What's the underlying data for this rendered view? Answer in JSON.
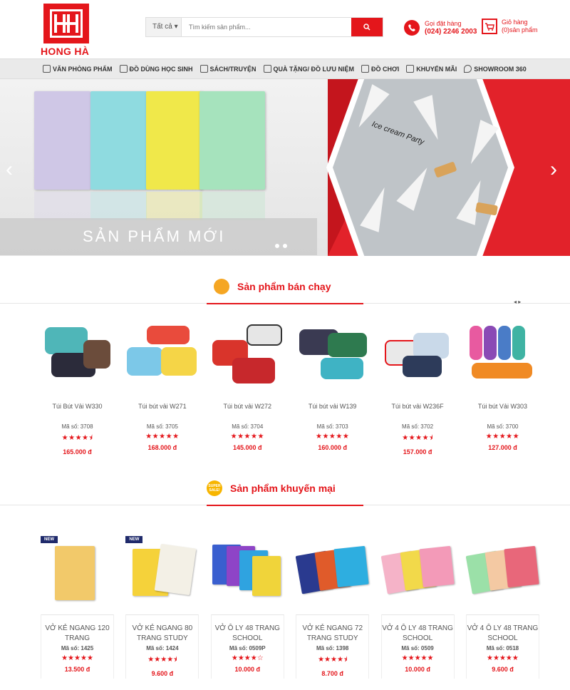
{
  "header": {
    "logo_text": "HONG HÀ",
    "search": {
      "category": "Tất cả",
      "placeholder": "Tìm kiếm sản phẩm..."
    },
    "hotline": {
      "label": "Gọi đặt hàng",
      "number": "(024) 2246 2003"
    },
    "cart": {
      "label": "Giỏ hàng",
      "count_text": "(0)sản phẩm"
    }
  },
  "nav": {
    "items": [
      {
        "label": "VĂN PHÒNG PHẨM",
        "icon": "pen-icon"
      },
      {
        "label": "ĐỒ DÙNG HỌC SINH",
        "icon": "school-supplies-icon"
      },
      {
        "label": "SÁCH/TRUYỆN",
        "icon": "book-icon"
      },
      {
        "label": "QUÀ TẶNG/ ĐỒ LƯU NIỆM",
        "icon": "gift-icon"
      },
      {
        "label": "ĐỒ CHƠI",
        "icon": "toy-icon"
      },
      {
        "label": "KHUYẾN MÃI",
        "icon": "promo-icon"
      },
      {
        "label": "SHOWROOM 360",
        "icon": "location-icon"
      }
    ]
  },
  "banner": {
    "caption": "SẢN PHẨM MỚI",
    "cone_text": "Ice cream Party"
  },
  "bestsellers": {
    "title": "Sản phẩm bán chạy",
    "pager": "◂ ▸",
    "items": [
      {
        "name": "Túi Bút Vải W330",
        "sku": "Mã số: 3708",
        "stars": "★★★★⯨",
        "price": "165.000 đ"
      },
      {
        "name": "Túi bút vải W271",
        "sku": "Mã số: 3705",
        "stars": "★★★★★",
        "price": "168.000 đ"
      },
      {
        "name": "Túi bút vải W272",
        "sku": "Mã số: 3704",
        "stars": "★★★★★",
        "price": "145.000 đ"
      },
      {
        "name": "Túi bút vải W139",
        "sku": "Mã số: 3703",
        "stars": "★★★★★",
        "price": "160.000 đ"
      },
      {
        "name": "Túi bút vải W236F",
        "sku": "Mã số: 3702",
        "stars": "★★★★⯨",
        "price": "157.000 đ"
      },
      {
        "name": "Túi bút Vải W303",
        "sku": "Mã số: 3700",
        "stars": "★★★★★",
        "price": "127.000 đ"
      }
    ]
  },
  "promotions": {
    "title": "Sản phẩm khuyến mại",
    "badge_icon_text": "SUPER SALE!",
    "items": [
      {
        "badge": "NEW",
        "name": "VỞ KẺ NGANG 120 TRANG",
        "sku": "Mã số: 1425",
        "stars": "★★★★★",
        "price": "13.500 đ"
      },
      {
        "badge": "NEW",
        "name": "VỞ KẺ NGANG 80 TRANG STUDY",
        "sku": "Mã số: 1424",
        "stars": "★★★★⯨",
        "price": "9.600 đ"
      },
      {
        "badge": "",
        "name": "VỞ Ô LY 48 TRANG SCHOOL",
        "sku": "Mã số: 0509P",
        "stars": "★★★★☆",
        "price": "10.000 đ"
      },
      {
        "badge": "",
        "name": "VỞ KẺ NGANG 72 TRANG STUDY",
        "sku": "Mã số: 1398",
        "stars": "★★★★⯨",
        "price": "8.700 đ"
      },
      {
        "badge": "",
        "name": "VỞ 4 Ô LY 48 TRANG SCHOOL",
        "sku": "Mã số: 0509",
        "stars": "★★★★★",
        "price": "10.000 đ"
      },
      {
        "badge": "",
        "name": "VỞ 4 Ô LY 48 TRANG SCHOOL",
        "sku": "Mã số: 0518",
        "stars": "★★★★★",
        "price": "9.600 đ"
      }
    ]
  },
  "colors": {
    "brand_red": "#e4161b",
    "nav_bg": "#eaeaea"
  }
}
